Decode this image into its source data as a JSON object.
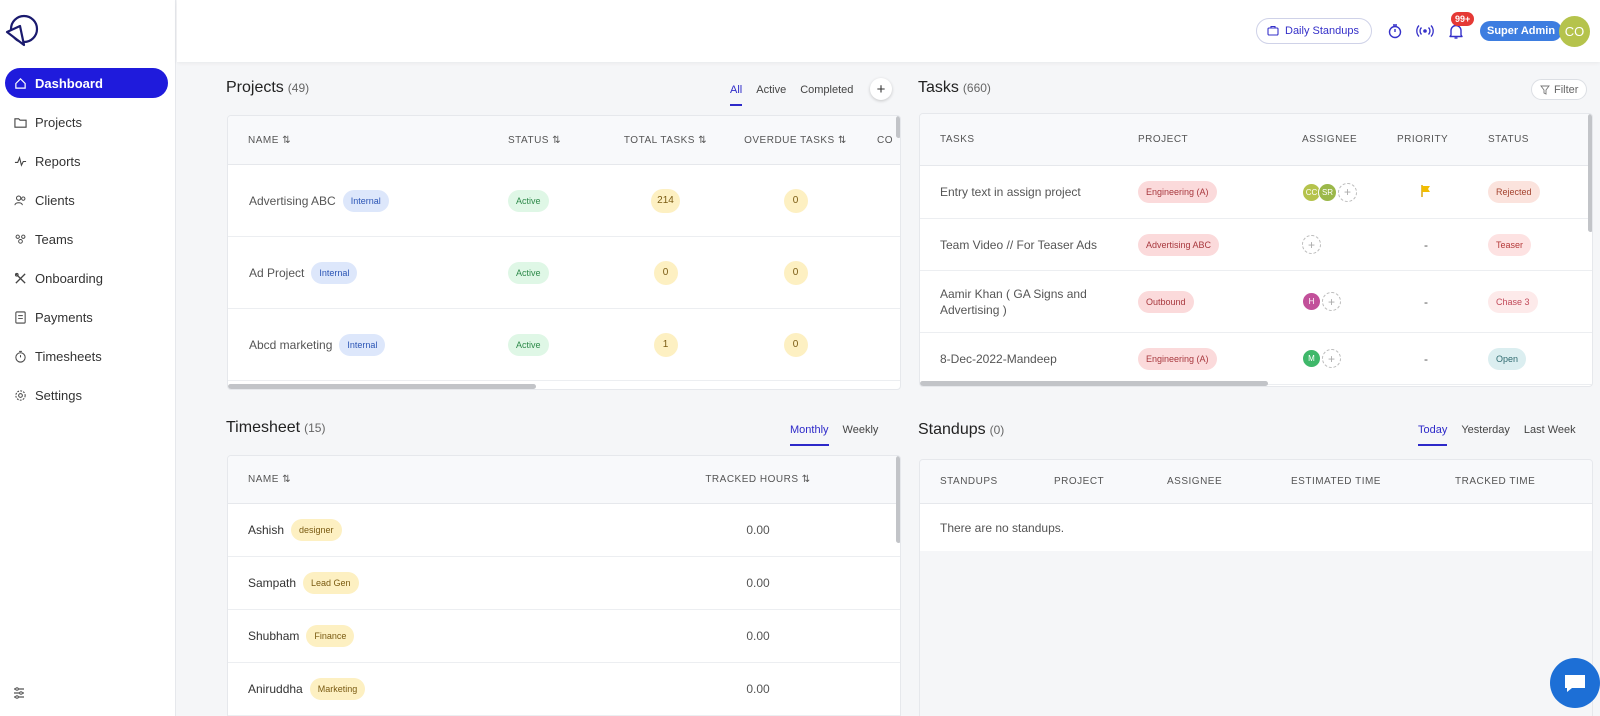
{
  "sidebar": {
    "items": [
      {
        "label": "Dashboard",
        "icon": "home-icon",
        "active": true
      },
      {
        "label": "Projects",
        "icon": "folder-icon"
      },
      {
        "label": "Reports",
        "icon": "pulse-icon"
      },
      {
        "label": "Clients",
        "icon": "users-icon"
      },
      {
        "label": "Teams",
        "icon": "team-icon"
      },
      {
        "label": "Onboarding",
        "icon": "tools-icon"
      },
      {
        "label": "Payments",
        "icon": "invoice-icon"
      },
      {
        "label": "Timesheets",
        "icon": "stopwatch-icon"
      },
      {
        "label": "Settings",
        "icon": "gear-icon"
      }
    ]
  },
  "header": {
    "standups_label": "Daily Standups",
    "notif_badge": "99+",
    "role": "Super Admin",
    "avatar": "CO"
  },
  "projects": {
    "title": "Projects",
    "count": "(49)",
    "tabs": [
      "All",
      "Active",
      "Completed"
    ],
    "columns": [
      "NAME",
      "STATUS",
      "TOTAL TASKS",
      "OVERDUE TASKS",
      "CO"
    ],
    "rows": [
      {
        "name": "Advertising ABC",
        "tag": "Internal",
        "status": "Active",
        "total": "214",
        "overdue": "0"
      },
      {
        "name": "Ad Project",
        "tag": "Internal",
        "status": "Active",
        "total": "0",
        "overdue": "0"
      },
      {
        "name": "Abcd marketing",
        "tag": "Internal",
        "status": "Active",
        "total": "1",
        "overdue": "0"
      }
    ]
  },
  "tasks": {
    "title": "Tasks",
    "count": "(660)",
    "filter_label": "Filter",
    "columns": [
      "TASKS",
      "PROJECT",
      "ASSIGNEE",
      "PRIORITY",
      "STATUS"
    ],
    "rows": [
      {
        "task": "Entry text in assign project",
        "project": "Engineering (A)",
        "assignees": [
          "CC",
          "SR"
        ],
        "priority": "flag",
        "status": "Rejected"
      },
      {
        "task": "Team Video // For Teaser Ads",
        "project": "Advertising ABC",
        "assignees": [],
        "priority": "-",
        "status": "Teaser"
      },
      {
        "task": "Aamir Khan ( GA Signs and Advertising )",
        "project": "Outbound",
        "assignees": [
          "H"
        ],
        "priority": "-",
        "status": "Chase 3"
      },
      {
        "task": "8-Dec-2022-Mandeep",
        "project": "Engineering (A)",
        "assignees": [
          "M"
        ],
        "priority": "-",
        "status": "Open"
      }
    ]
  },
  "timesheet": {
    "title": "Timesheet",
    "count": "(15)",
    "tabs": [
      "Monthly",
      "Weekly"
    ],
    "columns": [
      "NAME",
      "TRACKED HOURS"
    ],
    "rows": [
      {
        "name": "Ashish",
        "tag": "designer",
        "hours": "0.00"
      },
      {
        "name": "Sampath",
        "tag": "Lead Gen",
        "hours": "0.00"
      },
      {
        "name": "Shubham",
        "tag": "Finance",
        "hours": "0.00"
      },
      {
        "name": "Aniruddha",
        "tag": "Marketing",
        "hours": "0.00"
      }
    ]
  },
  "standups": {
    "title": "Standups",
    "count": "(0)",
    "tabs": [
      "Today",
      "Yesterday",
      "Last Week"
    ],
    "columns": [
      "STANDUPS",
      "PROJECT",
      "ASSIGNEE",
      "ESTIMATED TIME",
      "TRACKED TIME"
    ],
    "empty": "There are no standups."
  },
  "colors": {
    "primary": "#1f1bdc",
    "accent": "#2d29c9",
    "role": "#3d7de0",
    "badge": "#e53935"
  }
}
